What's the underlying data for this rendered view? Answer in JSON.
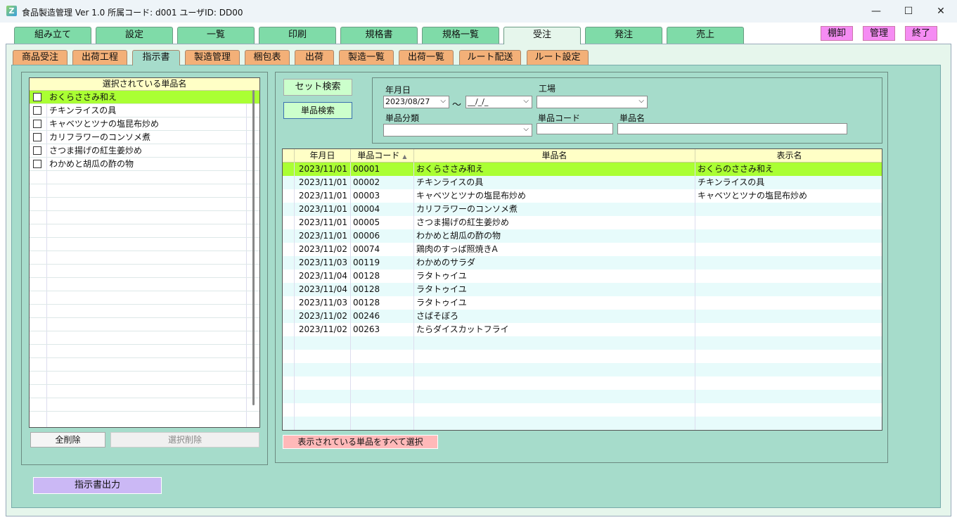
{
  "window": {
    "title": "食品製造管理 Ver 1.0  所属コード: d001    ユーザID: DD00",
    "minimize": "—",
    "maximize": "☐",
    "close": "✕"
  },
  "main_tabs": [
    "組み立て",
    "設定",
    "一覧",
    "印刷",
    "規格書",
    "規格一覧",
    "受注",
    "発注",
    "売上"
  ],
  "corner_buttons": [
    "棚卸",
    "管理",
    "終了"
  ],
  "sub_tabs": [
    "商品受注",
    "出荷工程",
    "指示書",
    "製造管理",
    "梱包表",
    "出荷",
    "製造一覧",
    "出荷一覧",
    "ルート配送",
    "ルート設定"
  ],
  "left_list": {
    "header": "選択されている単品名",
    "items": [
      "おくらささみ和え",
      "チキンライスの具",
      "キャベツとツナの塩昆布炒め",
      "カリフラワーのコンソメ煮",
      "さつま揚げの紅生姜炒め",
      "わかめと胡瓜の酢の物"
    ]
  },
  "left_buttons": {
    "delete_all": "全削除",
    "delete_selected": "選択削除",
    "output": "指示書出力"
  },
  "search": {
    "set_search": "セット検索",
    "item_search": "単品検索",
    "date_label": "年月日",
    "date_from": "2023/08/27",
    "date_to": "__/_/_",
    "tilde": "～",
    "factory_label": "工場",
    "category_label": "単品分類",
    "code_label": "単品コード",
    "name_label": "単品名"
  },
  "grid": {
    "columns": [
      "年月日",
      "単品コード",
      "単品名",
      "表示名"
    ],
    "sort_indicator": "▲",
    "rows": [
      [
        "2023/11/01",
        "00001",
        "おくらささみ和え",
        "おくらのささみ和え"
      ],
      [
        "2023/11/01",
        "00002",
        "チキンライスの具",
        "チキンライスの具"
      ],
      [
        "2023/11/01",
        "00003",
        "キャベツとツナの塩昆布炒め",
        "キャベツとツナの塩昆布炒め"
      ],
      [
        "2023/11/01",
        "00004",
        "カリフラワーのコンソメ煮",
        ""
      ],
      [
        "2023/11/01",
        "00005",
        "さつま揚げの紅生姜炒め",
        ""
      ],
      [
        "2023/11/01",
        "00006",
        "わかめと胡瓜の酢の物",
        ""
      ],
      [
        "2023/11/02",
        "00074",
        "鶏肉のすっぱ照焼きA",
        ""
      ],
      [
        "2023/11/03",
        "00119",
        "わかめのサラダ",
        ""
      ],
      [
        "2023/11/04",
        "00128",
        "ラタトゥイユ",
        ""
      ],
      [
        "2023/11/04",
        "00128",
        "ラタトゥイユ",
        ""
      ],
      [
        "2023/11/03",
        "00128",
        "ラタトゥイユ",
        ""
      ],
      [
        "2023/11/02",
        "00246",
        "さばそぼろ",
        ""
      ],
      [
        "2023/11/02",
        "00263",
        "たらダイスカットフライ",
        ""
      ]
    ]
  },
  "select_all_button": "表示されている単品をすべて選択",
  "colors": {
    "main_tab": "#7fdba8",
    "sub_tab": "#f3b078",
    "panel": "#a6dccb",
    "selected_row": "#aaff33",
    "corner_button": "#f58cf3",
    "output_button": "#cbb8f5",
    "select_all_button": "#ffb9b9"
  }
}
